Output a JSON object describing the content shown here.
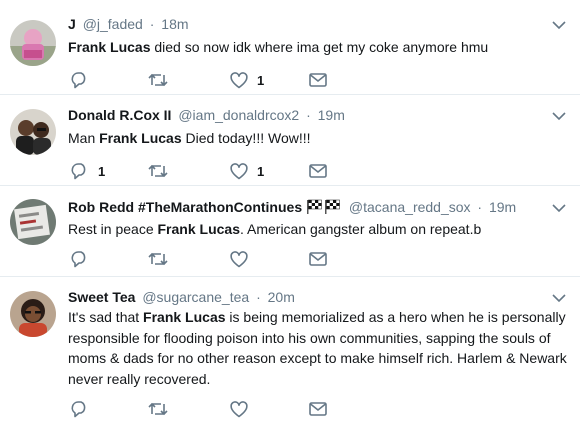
{
  "tweets": [
    {
      "name": "J",
      "handle": "@j_faded",
      "sep": "·",
      "time": "18m",
      "text_parts": [
        "",
        "Frank Lucas",
        " died so now idk where ima get my coke anymore hmu"
      ],
      "reply_count": "",
      "retweet_count": "",
      "like_count": "1"
    },
    {
      "name": "Donald R.Cox II",
      "handle": "@iam_donaldrcox2",
      "sep": "·",
      "time": "19m",
      "text_parts": [
        "Man ",
        "Frank Lucas",
        " Died today!!! Wow!!!"
      ],
      "reply_count": "1",
      "retweet_count": "",
      "like_count": "1"
    },
    {
      "name": "Rob Redd #TheMarathonContinues",
      "name_emoji": "🏁🏁",
      "handle": "@tacana_redd_sox",
      "sep": "·",
      "time": "19m",
      "text_parts": [
        "Rest in peace ",
        "Frank Lucas",
        ". American gangster album on repeat.b"
      ],
      "reply_count": "",
      "retweet_count": "",
      "like_count": ""
    },
    {
      "name": "Sweet Tea",
      "handle": "@sugarcane_tea",
      "sep": "·",
      "time": "20m",
      "text_parts": [
        "It's sad that ",
        "Frank Lucas",
        " is being memorialized as a hero when he is personally responsible for flooding poison into his own communities, sapping the souls of moms & dads for no other reason except to make himself rich. Harlem & Newark never really recovered."
      ],
      "reply_count": "",
      "retweet_count": "",
      "like_count": ""
    }
  ],
  "icons": {
    "reply": "reply-icon",
    "retweet": "retweet-icon",
    "like": "heart-icon",
    "dm": "envelope-icon",
    "more": "chevron-down-icon"
  },
  "colors": {
    "icon_gray": "#657786",
    "text": "#14171a",
    "divider": "#e6ecf0"
  }
}
